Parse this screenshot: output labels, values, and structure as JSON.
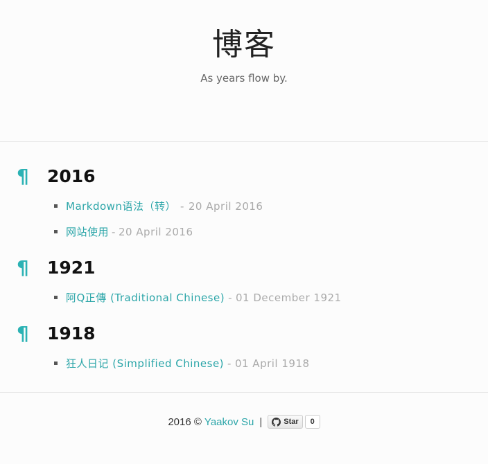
{
  "header": {
    "title": "博客",
    "description": "As years flow by."
  },
  "archive": [
    {
      "year": "2016",
      "posts": [
        {
          "title": "Markdown语法（转）",
          "date": "20 April 2016"
        },
        {
          "title": "网站使用",
          "date": "20 April 2016"
        }
      ]
    },
    {
      "year": "1921",
      "posts": [
        {
          "title": "阿Q正傳 (Traditional Chinese)",
          "date": "01 December 1921"
        }
      ]
    },
    {
      "year": "1918",
      "posts": [
        {
          "title": "狂人日记 (Simplified Chinese)",
          "date": "01 April 1918"
        }
      ]
    }
  ],
  "pilcrow": "¶",
  "separator": "-",
  "footer": {
    "copyright": "2016 ©",
    "author": "Yaakov Su",
    "pipe": "|",
    "star_label": "Star",
    "star_count": "0",
    "icon": "github-icon"
  },
  "colors": {
    "accent": "#2aa5a8",
    "date": "#aaaaaa",
    "background": "#fcfcfc"
  }
}
